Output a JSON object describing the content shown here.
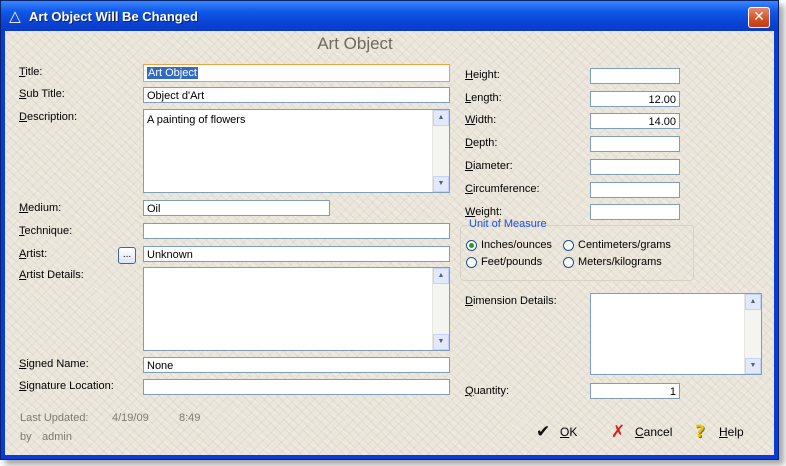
{
  "window": {
    "title": "Art Object Will Be Changed",
    "close_glyph": "✕",
    "title_icon": "triangle-app-icon"
  },
  "heading": "Art Object",
  "labels": {
    "title_u": "T",
    "title_rest": "itle:",
    "subtitle_u": "S",
    "subtitle_rest": "ub Title:",
    "description_u": "D",
    "description_rest": "escription:",
    "medium_u": "M",
    "medium_rest": "edium:",
    "technique_u": "T",
    "technique_rest": "echnique:",
    "artist_u": "A",
    "artist_rest": "rtist:",
    "artist_details_u": "A",
    "artist_details_rest": "rtist Details:",
    "signed_name_u": "S",
    "signed_name_rest": "igned Name:",
    "signature_location_u": "S",
    "signature_location_rest": "ignature Location:",
    "height_u": "H",
    "height_rest": "eight:",
    "length_u": "L",
    "length_rest": "ength:",
    "width_u": "W",
    "width_rest": "idth:",
    "depth_u": "D",
    "depth_rest": "epth:",
    "diameter_u": "D",
    "diameter_rest": "iameter:",
    "circumference_u": "C",
    "circumference_rest": "ircumference:",
    "weight_u": "W",
    "weight_rest": "eight:",
    "dimension_details_u": "D",
    "dimension_details_rest": "imension Details:",
    "quantity_u": "Q",
    "quantity_rest": "uantity:"
  },
  "fields": {
    "title": "Art Object",
    "subtitle": "Object d'Art",
    "description": "A painting of flowers",
    "medium": "Oil",
    "technique": "",
    "artist": "Unknown",
    "artist_details": "",
    "signed_name": "None",
    "signature_location": "",
    "height": "",
    "length": "12.00",
    "width": "14.00",
    "depth": "",
    "diameter": "",
    "circumference": "",
    "weight": "",
    "dimension_details": "",
    "quantity": "1"
  },
  "artist_button": "...",
  "unit_of_measure": {
    "title": "Unit of Measure",
    "options": [
      "Inches/ounces",
      "Centimeters/grams",
      "Feet/pounds",
      "Meters/kilograms"
    ],
    "selected": "Inches/ounces"
  },
  "footer": {
    "last_updated_label": "Last Updated:",
    "date": "4/19/09",
    "time": "8:49",
    "by_label": "by",
    "user": "admin"
  },
  "buttons": {
    "ok_u": "O",
    "ok_rest": "K",
    "cancel_u": "C",
    "cancel_rest": "ancel",
    "help_u": "H",
    "help_rest": "elp"
  },
  "icons": {
    "ok": "checkmark-icon",
    "cancel": "red-x-icon",
    "help": "question-mark-icon"
  },
  "colors": {
    "title_bar": "#0a44d6",
    "group_title": "#1b4fd8",
    "selection": "#316ac5",
    "cancel_icon": "#d4201a",
    "help_icon": "#e8c21a"
  }
}
